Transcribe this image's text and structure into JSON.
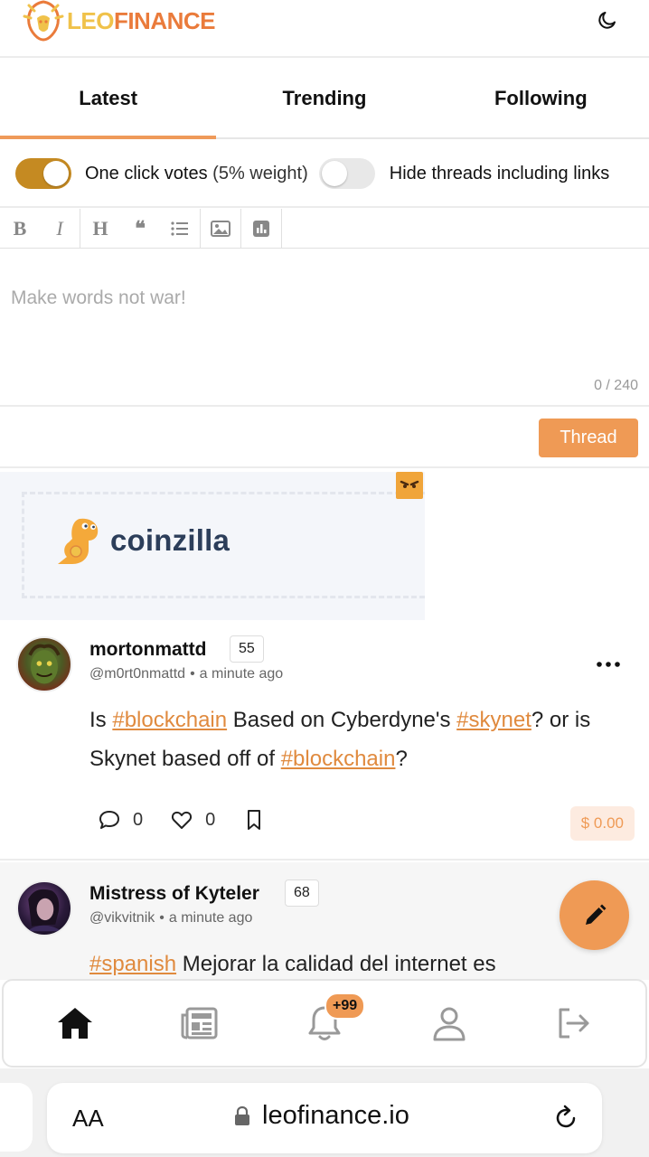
{
  "header": {
    "logo_leo": "LEO",
    "logo_finance": "FINANCE",
    "logo_icon": "lion-icon",
    "theme_icon": "moon-icon"
  },
  "tabs": [
    {
      "label": "Latest",
      "active": true
    },
    {
      "label": "Trending",
      "active": false
    },
    {
      "label": "Following",
      "active": false
    }
  ],
  "toggles": {
    "one_click": {
      "label": "One click votes",
      "detail": "(5% weight)",
      "on": true
    },
    "hide_links": {
      "label": "Hide threads including links",
      "on": false
    }
  },
  "toolbar": {
    "icons": [
      "bold-icon",
      "italic-icon",
      "heading-icon",
      "quote-icon",
      "list-icon",
      "image-icon",
      "poll-icon"
    ],
    "bold": "B",
    "italic": "I",
    "heading": "H",
    "quote": "❝"
  },
  "composer": {
    "placeholder": "Make words not war!",
    "count": "0 / 240",
    "button": "Thread"
  },
  "ad": {
    "brand": "coinzilla"
  },
  "posts": [
    {
      "username": "mortonmattd",
      "reputation": "55",
      "handle": "@m0rt0nmattd",
      "time": "a minute ago",
      "text": {
        "p1": "Is ",
        "tag1": "#blockchain",
        "p2": " Based on Cyberdyne's ",
        "tag2": "#skynet",
        "p3": "? or is Skynet based off of ",
        "tag3": "#blockchain",
        "p4": "?"
      },
      "comments": "0",
      "likes": "0",
      "payout": "$ 0.00"
    },
    {
      "username": "Mistress of Kyteler",
      "reputation": "68",
      "handle": "@vikvitnik",
      "time": "a minute ago",
      "text": {
        "tag1": "#spanish",
        "p1": " Mejorar la calidad del internet es"
      }
    }
  ],
  "bottom_nav": {
    "items": [
      "home-icon",
      "news-icon",
      "bell-icon",
      "profile-icon",
      "logout-icon"
    ],
    "notifications_badge": "+99"
  },
  "browser": {
    "text_size": "AA",
    "url": "leofinance.io"
  },
  "colors": {
    "accent": "#ef9a55",
    "toggle_on": "#c58a22",
    "tag": "#e08a3e"
  }
}
